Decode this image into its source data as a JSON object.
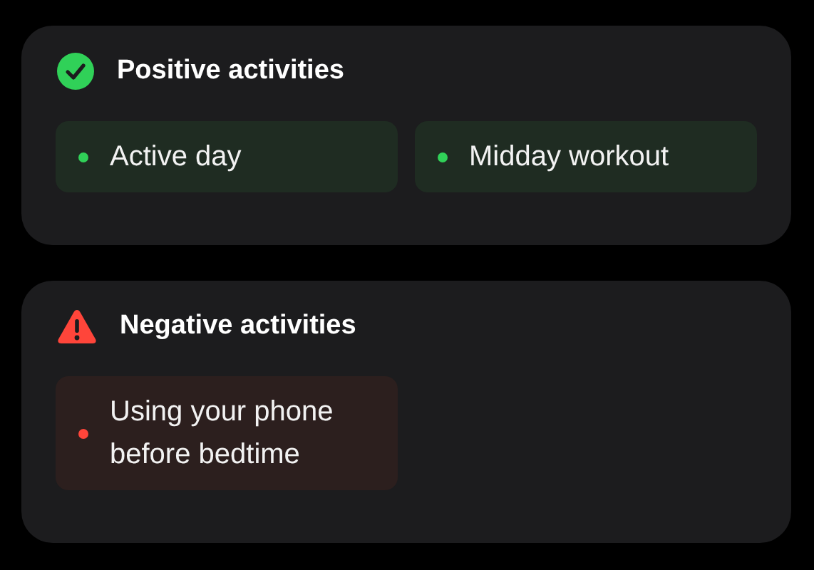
{
  "sections": [
    {
      "kind": "positive",
      "title": "Positive activities",
      "items": [
        {
          "label": "Active day"
        },
        {
          "label": "Midday workout"
        }
      ]
    },
    {
      "kind": "negative",
      "title": "Negative activities",
      "items": [
        {
          "label": "Using your phone before bedtime"
        }
      ]
    }
  ]
}
